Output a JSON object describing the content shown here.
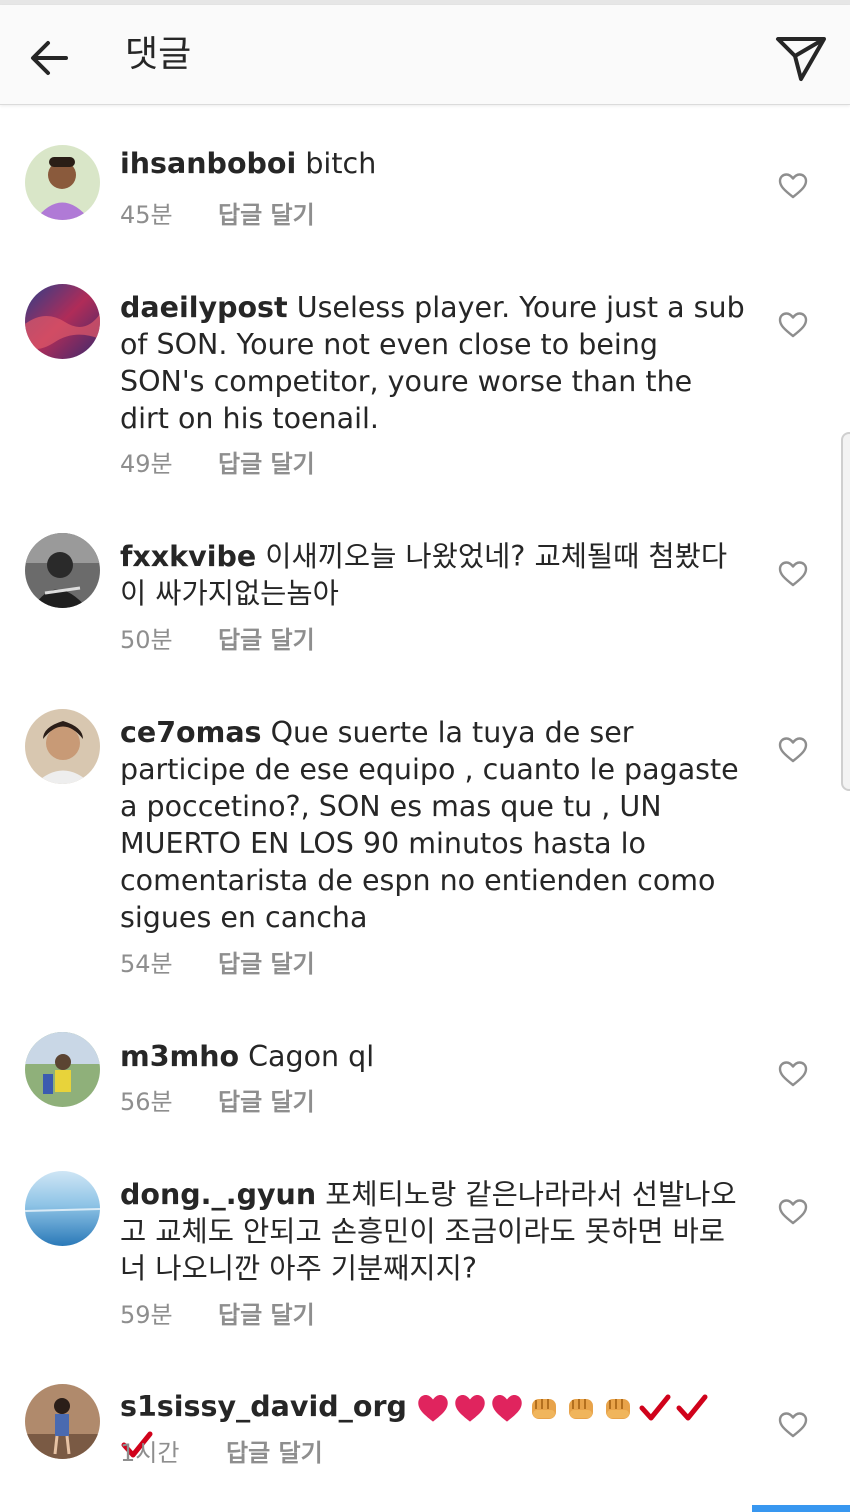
{
  "header": {
    "title": "댓글",
    "back_icon": "arrow-left-icon",
    "share_icon": "paper-plane-icon"
  },
  "reply_label": "답글 달기",
  "comments": [
    {
      "username": "ihsanboboi",
      "text": "bitch",
      "time": "45분"
    },
    {
      "username": "daeilypost",
      "text": "Useless player. Youre just a sub of SON. Youre not even close to being SON's competitor, youre worse than the dirt on his toenail.",
      "time": "49분"
    },
    {
      "username": "fxxkvibe",
      "text": "이새끼오늘 나왔었네? 교체될때 첨봤다 이 싸가지없는놈아",
      "time": "50분"
    },
    {
      "username": "ce7omas",
      "text": "Que suerte la tuya de ser participe de ese equipo , cuanto le pagaste a poccetino?, SON es mas que tu , UN MUERTO EN LOS 90 minutos hasta lo comentarista de espn no entienden como sigues en cancha",
      "time": "54분"
    },
    {
      "username": "m3mho",
      "text": "Cagon ql",
      "time": "56분"
    },
    {
      "username": "dong._.gyun",
      "text": "포체티노랑 같은나라라서 선발나오고 교체도 안되고 손흥민이 조금이라도 못하면 바로 너 나오니깐 아주 기분째지지?",
      "time": "59분"
    },
    {
      "username": "s1sissy_david_org",
      "text": "",
      "emoji": [
        "heart",
        "heart",
        "heart",
        "fist",
        "fist",
        "fist",
        "check",
        "check",
        "check"
      ],
      "time": "1시간"
    }
  ],
  "colors": {
    "text": "#262626",
    "meta": "#8e8e8e",
    "accent": "#3897f0",
    "heart_emoji": "#e0245e",
    "check": "#d0021b"
  }
}
